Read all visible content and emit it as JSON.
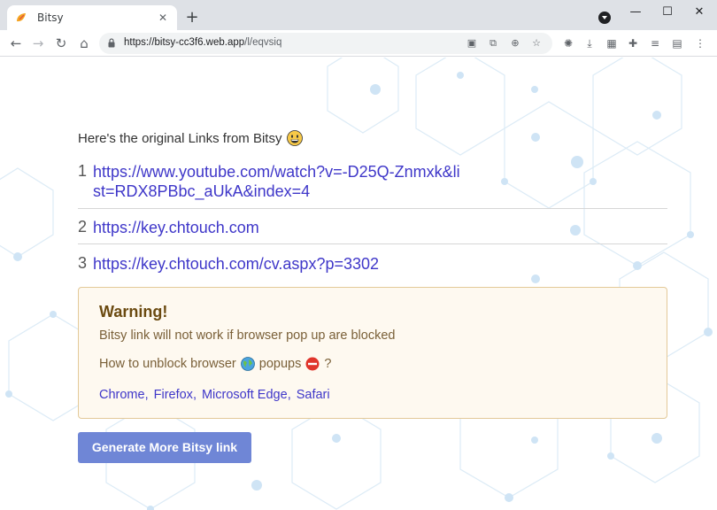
{
  "browser": {
    "tab_title": "Bitsy",
    "tab_close": "✕",
    "new_tab": "+",
    "url_host": "https://bitsy-cc3f6.web.app",
    "url_path": "/l/eqvsiq"
  },
  "page": {
    "intro_text": "Here's the original Links from Bitsy",
    "links": [
      {
        "num": "1",
        "url": "https://www.youtube.com/watch?v=-D25Q-Znmxk&list=RDX8PBbc_aUkA&index=4"
      },
      {
        "num": "2",
        "url": "https://key.chtouch.com"
      },
      {
        "num": "3",
        "url": "https://key.chtouch.com/cv.aspx?p=3302"
      }
    ],
    "warning": {
      "title": "Warning!",
      "message": "Bitsy link will not work if browser pop up are blocked",
      "how_prefix": "How to unblock browser",
      "how_mid": "popups",
      "how_suffix": "?",
      "browsers": [
        "Chrome",
        "Firefox",
        "Microsoft Edge",
        "Safari"
      ]
    },
    "generate_button": "Generate More Bitsy link"
  },
  "colors": {
    "link": "#3f37c9",
    "button": "#6f86d6",
    "warning_bg": "#fef9f0",
    "warning_border": "#e3c998"
  }
}
